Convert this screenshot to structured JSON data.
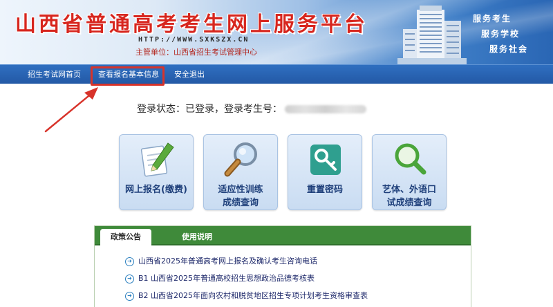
{
  "header": {
    "title": "山西省普通高考考生网上服务平台",
    "url": "HTTP://WWW.SXKSZX.CN",
    "org": "主管单位：山西省招生考试管理中心",
    "slogans": [
      "服务考生",
      "服务学校",
      "服务社会"
    ]
  },
  "nav": {
    "items": [
      {
        "label": "招生考试网首页"
      },
      {
        "label": "查看报名基本信息"
      },
      {
        "label": "安全退出"
      }
    ]
  },
  "status": {
    "text": "登录状态：已登录，登录考生号："
  },
  "tiles": [
    {
      "label": "网上报名(缴费)",
      "icon": "pen-paper-icon"
    },
    {
      "label": "适应性训练成绩查询",
      "icon": "magnifier-icon"
    },
    {
      "label": "重置密码",
      "icon": "key-icon"
    },
    {
      "label": "艺体、外语口试成绩查询",
      "icon": "search-icon"
    }
  ],
  "panel": {
    "tabs": [
      "政策公告",
      "使用说明"
    ],
    "notices": [
      "山西省2025年普通高考网上报名及确认考生咨询电话",
      "B1 山西省2025年普通高校招生思想政治品德考核表",
      "B2 山西省2025年面向农村和脱贫地区招生专项计划考生资格审查表"
    ]
  },
  "colors": {
    "title_red": "#d7261e",
    "nav_blue": "#2f6fc0",
    "panel_green": "#3f8a3a",
    "highlight_red": "#d8332a"
  }
}
